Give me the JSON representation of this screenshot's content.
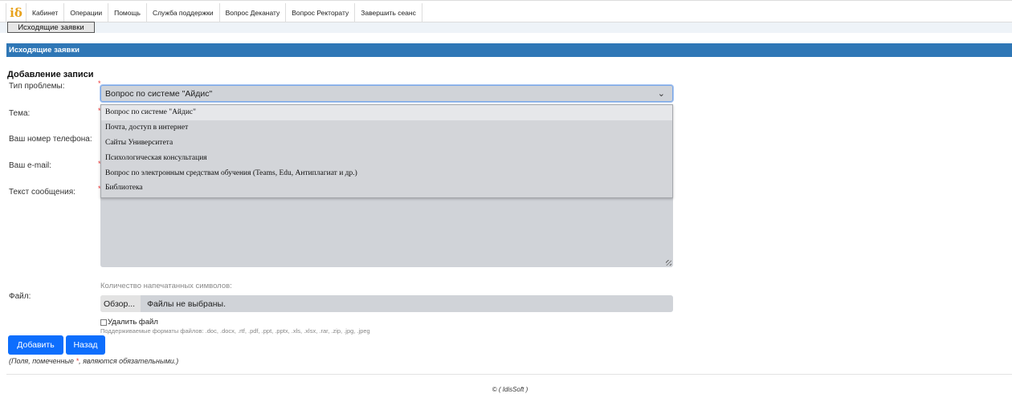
{
  "nav": {
    "logo": "iδ",
    "items": [
      "Кабинет",
      "Операции",
      "Помощь",
      "Служба поддержки",
      "Вопрос Деканату",
      "Вопрос Ректорату",
      "Завершить сеанс"
    ]
  },
  "subnav": {
    "button": "Исходящие заявки"
  },
  "section": {
    "title": "Исходящие заявки"
  },
  "form": {
    "title": "Добавление записи",
    "labels": {
      "problem_type": "Тип проблемы:",
      "topic": "Тема:",
      "phone": "Ваш номер телефона:",
      "email": "Ваш e-mail:",
      "message": "Текст сообщения:",
      "file": "Файл:"
    },
    "required_mark": "*",
    "problem_type": {
      "selected": "Вопрос по системе \"Айдис\"",
      "options": [
        "Вопрос по системе \"Айдис\"",
        "Почта, доступ в интернет",
        "Сайты Университета",
        "Психологическая консультация",
        "Вопрос по электронным средствам обучения (Teams, Edu, Антиплагиат и др.)",
        "Библиотека"
      ]
    },
    "counter_label": "Количество напечатанных символов:",
    "file": {
      "browse": "Обзор...",
      "status": "Файлы не выбраны."
    },
    "delete_file": "Удалить файл",
    "formats": "Поддерживаемые форматы файлов: .doc, .docx, .rtf, .pdf, .ppt, .pptx, .xls, .xlsx, .rar, .zip, .jpg, .jpeg",
    "buttons": {
      "add": "Добавить",
      "back": "Назад"
    },
    "note_before": "(Поля, помеченные ",
    "note_star": "*",
    "note_after": ", являются обязательными.)"
  },
  "footer": {
    "text": "© ( IdisSoft )"
  },
  "colors": {
    "header_blue": "#2f77b6",
    "button_blue": "#0d6efd",
    "required_red": "#e33333",
    "field_gray": "#d0d3d8"
  },
  "icons": {
    "select_chevron": "chevron-down-icon"
  }
}
